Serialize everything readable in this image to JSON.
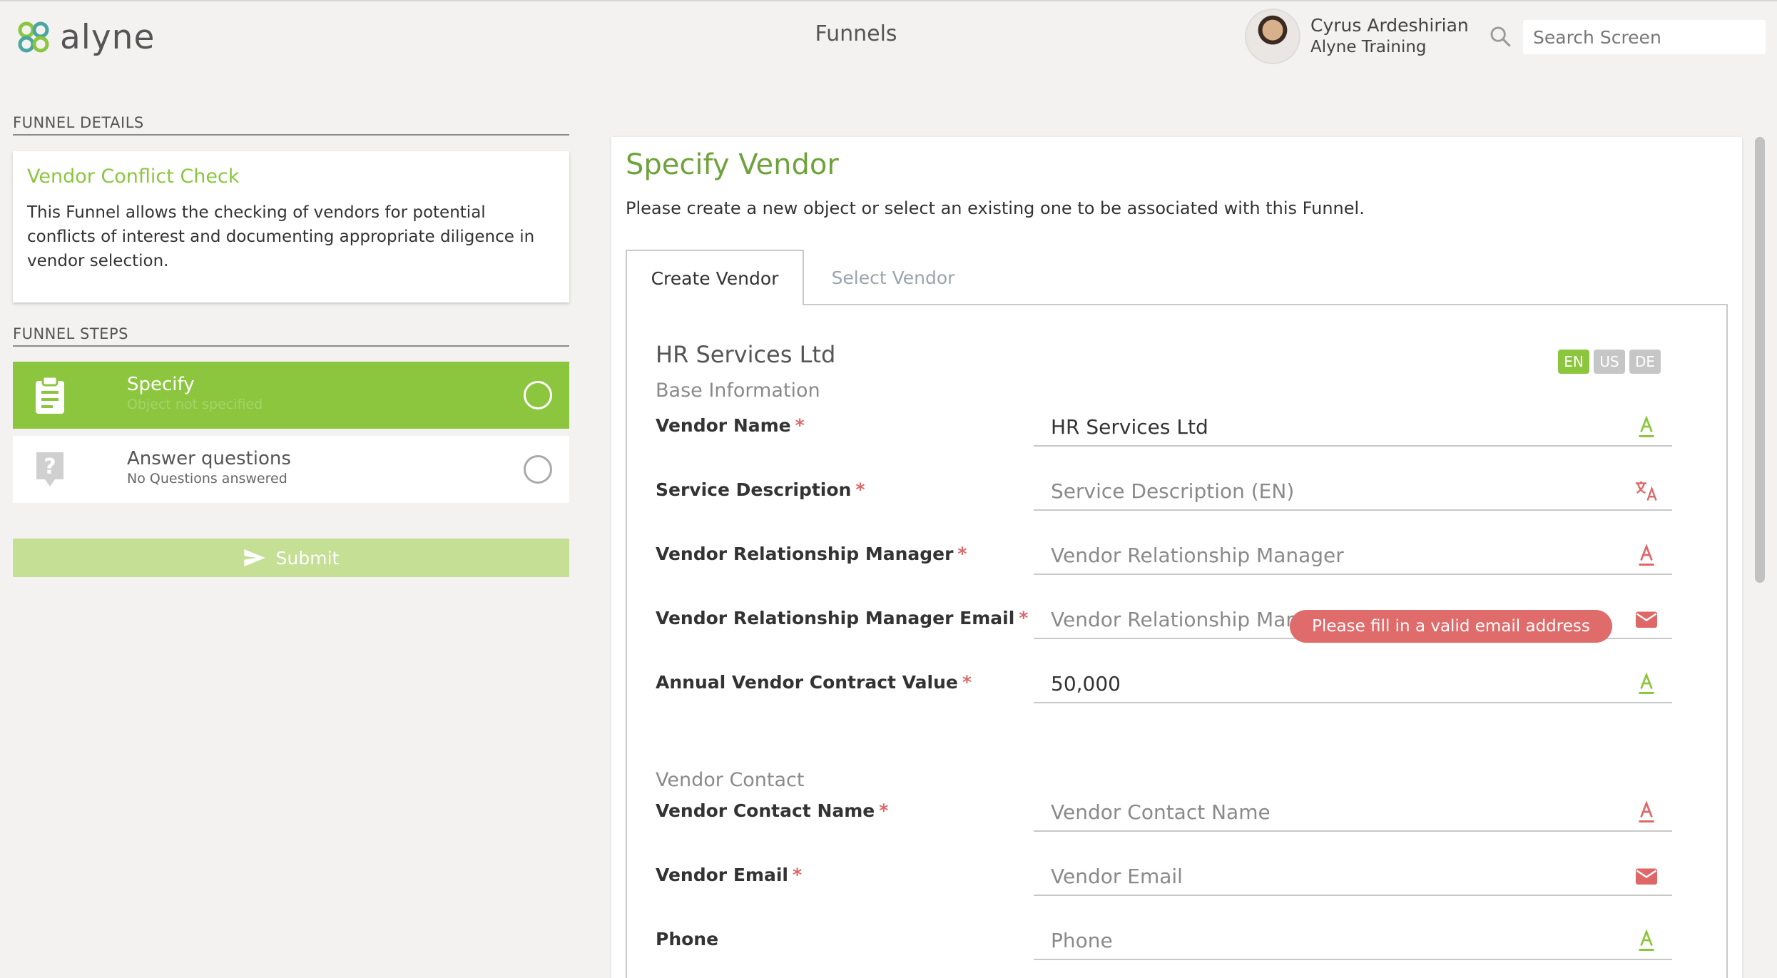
{
  "header": {
    "logo_text": "alyne",
    "page_title": "Funnels",
    "user_name": "Cyrus Ardeshirian",
    "user_org": "Alyne Training",
    "search_placeholder": "Search Screen"
  },
  "sidebar": {
    "details_heading": "FUNNEL DETAILS",
    "funnel_title": "Vendor Conflict Check",
    "funnel_description": "This Funnel allows the checking of vendors for potential conflicts of interest and documenting appropriate diligence in vendor selection.",
    "steps_heading": "FUNNEL STEPS",
    "steps": [
      {
        "title": "Specify",
        "subtitle": "Object not specified"
      },
      {
        "title": "Answer questions",
        "subtitle": "No Questions answered"
      }
    ],
    "submit_label": "Submit"
  },
  "main": {
    "title": "Specify Vendor",
    "subtitle": "Please create a new object or select an existing one to be associated with this Funnel.",
    "tabs": [
      {
        "label": "Create Vendor"
      },
      {
        "label": "Select Vendor"
      }
    ],
    "object_name": "HR Services Ltd",
    "languages": [
      "EN",
      "US",
      "DE"
    ],
    "groups": {
      "base": "Base Information",
      "contact": "Vendor Contact"
    },
    "fields": {
      "vendor_name": {
        "label": "Vendor Name",
        "value": "HR Services Ltd",
        "placeholder": ""
      },
      "service_description": {
        "label": "Service Description",
        "value": "",
        "placeholder": "Service Description (EN)"
      },
      "relationship_manager": {
        "label": "Vendor Relationship Manager",
        "value": "",
        "placeholder": "Vendor Relationship Manager"
      },
      "relationship_manager_email": {
        "label": "Vendor Relationship Manager Email",
        "value": "",
        "placeholder": "Vendor Relationship Manager Email"
      },
      "annual_contract_value": {
        "label": "Annual Vendor Contract Value",
        "value": "50,000",
        "placeholder": ""
      },
      "contact_name": {
        "label": "Vendor Contact Name",
        "value": "",
        "placeholder": "Vendor Contact Name"
      },
      "vendor_email": {
        "label": "Vendor Email",
        "value": "",
        "placeholder": "Vendor Email"
      },
      "phone": {
        "label": "Phone",
        "value": "",
        "placeholder": "Phone"
      }
    },
    "required_marker": "*",
    "error_message": "Please fill in a valid email address"
  },
  "colors": {
    "accent_green": "#8cc63f",
    "title_green": "#6ea33b",
    "error_red": "#e06b6b"
  },
  "icons": {
    "logo": "alyne-logo-icon",
    "search": "search-icon",
    "specify_step": "clipboard-icon",
    "answer_step": "question-icon",
    "submit": "send-icon",
    "text_field": "text-format-icon",
    "translate_field": "translate-icon",
    "email_field": "mail-icon"
  }
}
